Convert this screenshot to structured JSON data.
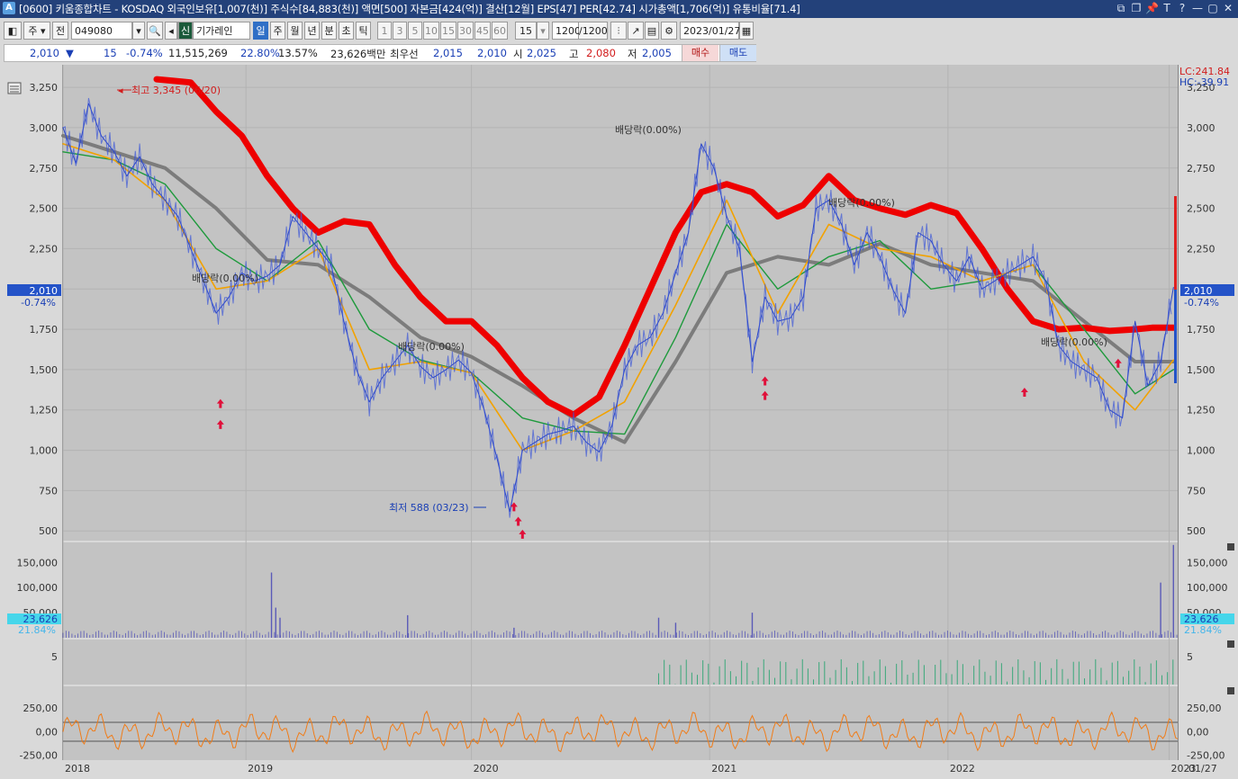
{
  "window": {
    "app_icon": "A",
    "title": "[0600] 키움종합차트 - KOSDAQ 외국인보유[1,007(천)] 주식수[84,883(천)] 액면[500] 자본금[424(억)] 결산[12월] EPS[47] PER[42.74] 시가총액[1,706(억)] 유통비율[71.4]",
    "controls": [
      "restore-icon",
      "tile-icon",
      "pin-icon",
      "font-icon",
      "help-icon",
      "minimize-icon",
      "maximize-icon",
      "close-icon"
    ],
    "control_glyphs": [
      "⧉",
      "❐",
      "📌",
      "T",
      "?",
      "—",
      "▢",
      "✕"
    ]
  },
  "toolbar": {
    "type_select": "주",
    "all_label": "전",
    "code": "049080",
    "stock_name": "기가레인",
    "stock_badge": "신",
    "periods": [
      "일",
      "주",
      "월",
      "년",
      "분",
      "초",
      "틱"
    ],
    "period_selected": "일",
    "intervals": [
      "1",
      "3",
      "5",
      "10",
      "15",
      "30",
      "45",
      "60"
    ],
    "interval_select": "15",
    "count": "1200",
    "count_total": "/1200",
    "date": "2023/01/27"
  },
  "quote": {
    "price": "2,010",
    "change_arrow": "▼",
    "change": "15",
    "change_pct": "-0.74%",
    "volume": "11,515,269",
    "volume_pct": "22.80%",
    "turnover": "13.57%",
    "amount": "23,626백만",
    "ask_label": "최우선",
    "ask1": "2,015",
    "bid1": "2,010",
    "open_label": "시",
    "open": "2,025",
    "high_label": "고",
    "high": "2,080",
    "low_label": "저",
    "low": "2,005",
    "buy_button": "매수",
    "sell_button": "매도"
  },
  "chart_data": {
    "type": "line",
    "main": {
      "lc_label": "LC:241.84",
      "hc_label": "HC:-39.91",
      "y_ticks": [
        "3,250",
        "3,000",
        "2,750",
        "2,500",
        "2,250",
        "2,000",
        "1,750",
        "1,500",
        "1,250",
        "1,000",
        "750",
        "500"
      ],
      "y_tick_values": [
        3250,
        3000,
        2750,
        2500,
        2250,
        2000,
        1750,
        1500,
        1250,
        1000,
        750,
        500
      ],
      "ylim": [
        440,
        3390
      ],
      "current_price": "2,010",
      "current_change": "-0.74%",
      "annotations": {
        "high": "최고 3,345 (06/20)",
        "low": "최저 588 (03/23)",
        "dividend": "배당락(0.00%)"
      },
      "series": [
        {
          "name": "price",
          "color": "#2a46c8",
          "x": [
            0,
            3,
            6,
            9,
            12,
            15,
            18,
            21,
            24,
            27,
            30,
            33,
            36,
            39,
            42,
            45,
            48,
            51,
            54,
            57,
            60,
            63,
            66,
            69,
            72,
            75,
            78,
            81,
            84,
            87,
            90,
            93,
            96,
            99,
            102,
            105,
            108,
            111,
            114,
            117,
            120,
            123,
            126,
            129,
            132,
            135,
            138,
            141,
            144,
            147,
            150,
            153,
            156,
            159,
            162,
            165,
            168,
            171,
            174,
            177,
            180,
            183,
            186,
            189,
            192,
            195,
            198,
            201,
            204,
            207,
            210,
            213,
            216,
            219,
            222,
            225,
            228,
            231,
            234,
            237,
            240,
            243,
            246,
            249,
            252,
            255,
            258,
            261
          ],
          "values": [
            3000,
            2780,
            3150,
            2950,
            2850,
            2700,
            2820,
            2650,
            2550,
            2450,
            2250,
            2050,
            1850,
            1950,
            2100,
            2050,
            2080,
            2150,
            2450,
            2350,
            2250,
            2150,
            1800,
            1500,
            1300,
            1450,
            1550,
            1650,
            1520,
            1450,
            1500,
            1560,
            1480,
            1250,
            950,
            620,
            1000,
            1050,
            1100,
            1120,
            1150,
            1050,
            990,
            1150,
            1500,
            1650,
            1700,
            1850,
            2100,
            2350,
            2900,
            2750,
            2450,
            2250,
            1550,
            1950,
            1800,
            1820,
            1950,
            2500,
            2550,
            2400,
            2150,
            2350,
            2200,
            2000,
            1850,
            2350,
            2300,
            2150,
            2050,
            2200,
            2000,
            2050,
            2100,
            2150,
            2200,
            2050,
            1650,
            1550,
            1500,
            1450,
            1250,
            1200,
            1800,
            1400,
            1550,
            2010
          ]
        },
        {
          "name": "ma-short",
          "color": "#f2a200",
          "x": [
            0,
            12,
            24,
            36,
            48,
            60,
            72,
            84,
            96,
            108,
            120,
            132,
            144,
            156,
            168,
            180,
            192,
            204,
            216,
            228,
            240,
            252,
            261
          ],
          "values": [
            2900,
            2800,
            2550,
            2000,
            2050,
            2250,
            1500,
            1550,
            1480,
            1000,
            1120,
            1300,
            1900,
            2550,
            1850,
            2400,
            2250,
            2200,
            2050,
            2150,
            1550,
            1250,
            1560
          ]
        },
        {
          "name": "ma-mid",
          "color": "#1e9a3c",
          "x": [
            0,
            12,
            24,
            36,
            48,
            60,
            72,
            84,
            96,
            108,
            120,
            132,
            144,
            156,
            168,
            180,
            192,
            204,
            216,
            228,
            240,
            252,
            261
          ],
          "values": [
            2850,
            2800,
            2650,
            2250,
            2050,
            2300,
            1750,
            1560,
            1480,
            1200,
            1120,
            1100,
            1700,
            2400,
            2000,
            2200,
            2300,
            2000,
            2050,
            2150,
            1750,
            1350,
            1500
          ]
        },
        {
          "name": "ma-long",
          "color": "#7c7c7c",
          "x": [
            0,
            12,
            24,
            36,
            48,
            60,
            72,
            84,
            96,
            108,
            120,
            132,
            144,
            156,
            168,
            180,
            192,
            204,
            216,
            228,
            240,
            252,
            261
          ],
          "values": [
            2950,
            2850,
            2750,
            2500,
            2180,
            2150,
            1950,
            1700,
            1580,
            1400,
            1200,
            1050,
            1550,
            2100,
            2200,
            2150,
            2280,
            2150,
            2100,
            2050,
            1800,
            1550,
            1550
          ]
        },
        {
          "name": "ma-trend",
          "color": "#ee0000",
          "x": [
            22,
            26,
            30,
            36,
            42,
            48,
            54,
            60,
            66,
            72,
            78,
            84,
            90,
            96,
            102,
            108,
            114,
            120,
            126,
            132,
            138,
            144,
            150,
            156,
            162,
            168,
            174,
            180,
            186,
            192,
            198,
            204,
            210,
            216,
            222,
            228,
            234,
            240,
            246,
            252,
            256,
            258,
            261
          ],
          "values": [
            3300,
            3290,
            3280,
            3100,
            2950,
            2700,
            2500,
            2350,
            2420,
            2400,
            2150,
            1950,
            1800,
            1800,
            1650,
            1450,
            1300,
            1220,
            1330,
            1650,
            2000,
            2350,
            2600,
            2650,
            2600,
            2450,
            2520,
            2700,
            2550,
            2500,
            2460,
            2520,
            2470,
            2250,
            2000,
            1800,
            1750,
            1760,
            1740,
            1750,
            1760,
            1760,
            1760
          ]
        }
      ],
      "markers": [
        {
          "x": 37,
          "y": 1290,
          "type": "up-arrow"
        },
        {
          "x": 37,
          "y": 1160,
          "type": "up-arrow"
        },
        {
          "x": 106,
          "y": 650,
          "type": "up-arrow"
        },
        {
          "x": 107,
          "y": 560,
          "type": "up-arrow"
        },
        {
          "x": 108,
          "y": 480,
          "type": "up-arrow"
        },
        {
          "x": 165,
          "y": 1430,
          "type": "up-arrow"
        },
        {
          "x": 165,
          "y": 1340,
          "type": "up-arrow"
        },
        {
          "x": 226,
          "y": 1360,
          "type": "up-arrow"
        },
        {
          "x": 248,
          "y": 1540,
          "type": "up-arrow"
        }
      ]
    },
    "volume": {
      "y_ticks": [
        "150,000",
        "100,000",
        "50,000"
      ],
      "y_tick_values": [
        150000,
        100000,
        50000
      ],
      "ylim": [
        0,
        190000
      ],
      "current": "23,626",
      "current_pct": "21.84%",
      "color": "#5a5ab8",
      "spikes": [
        {
          "x": 49,
          "v": 130000
        },
        {
          "x": 50,
          "v": 60000
        },
        {
          "x": 51,
          "v": 40000
        },
        {
          "x": 81,
          "v": 45000
        },
        {
          "x": 106,
          "v": 20000
        },
        {
          "x": 140,
          "v": 40000
        },
        {
          "x": 144,
          "v": 30000
        },
        {
          "x": 162,
          "v": 50000
        },
        {
          "x": 258,
          "v": 110000
        },
        {
          "x": 261,
          "v": 185000
        }
      ]
    },
    "foreign": {
      "y_ticks": [
        "5"
      ],
      "y_tick_values": [
        5
      ],
      "ylim": [
        0,
        8
      ],
      "color": "#3aa87a"
    },
    "oscillator": {
      "y_ticks": [
        "250,00",
        "0,00",
        "-250,00"
      ],
      "y_tick_values": [
        250,
        0,
        -250
      ],
      "ylim": [
        -300,
        480
      ],
      "color": "#f07c18",
      "ref_lines": [
        100,
        -100
      ]
    },
    "x_axis": {
      "years": [
        "2018",
        "2019",
        "2020",
        "2021",
        "2022",
        "2023"
      ],
      "year_pos": [
        0,
        43,
        96,
        152,
        208,
        260
      ],
      "date_label": "01/27",
      "x_max": 262
    }
  }
}
